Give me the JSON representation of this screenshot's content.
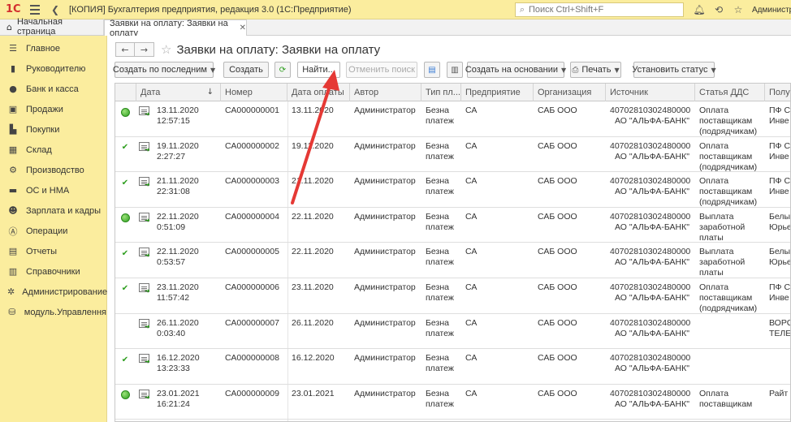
{
  "titlebar": {
    "logo": "1С",
    "app_title": "[КОПИЯ] Бухгалтерия предприятия, редакция 3.0  (1С:Предприятие)",
    "search_placeholder": "Поиск Ctrl+Shift+F",
    "user": "Администра",
    "colors": {
      "background": "#fbed9e"
    }
  },
  "tabs": {
    "home": "Начальная страница",
    "active": "Заявки на оплату: Заявки на оплату"
  },
  "sidebar": {
    "items": [
      {
        "label": "Главное",
        "icon": "menu-icon"
      },
      {
        "label": "Руководителю",
        "icon": "chart-icon"
      },
      {
        "label": "Банк и касса",
        "icon": "coin-icon"
      },
      {
        "label": "Продажи",
        "icon": "cart-icon"
      },
      {
        "label": "Покупки",
        "icon": "basket-icon"
      },
      {
        "label": "Склад",
        "icon": "warehouse-icon"
      },
      {
        "label": "Производство",
        "icon": "factory-icon"
      },
      {
        "label": "ОС и НМА",
        "icon": "truck-icon"
      },
      {
        "label": "Зарплата и кадры",
        "icon": "people-icon"
      },
      {
        "label": "Операции",
        "icon": "operations-icon"
      },
      {
        "label": "Отчеты",
        "icon": "report-icon"
      },
      {
        "label": "Справочники",
        "icon": "books-icon"
      },
      {
        "label": "Администрирование",
        "icon": "gear-icon"
      },
      {
        "label": "модуль.Управлення",
        "icon": "module-icon"
      }
    ]
  },
  "page": {
    "title": "Заявки на оплату: Заявки на оплату"
  },
  "toolbar": {
    "create_by_last": "Создать по последним",
    "create": "Создать",
    "find": "Найти...",
    "cancel_search": "Отменить поиск",
    "create_based_on": "Создать на основании",
    "print": "Печать",
    "set_status": "Установить статус"
  },
  "table": {
    "columns": [
      "Дата",
      "Номер",
      "Дата оплаты",
      "Автор",
      "Тип пл...",
      "Предприятие",
      "Организация",
      "Источник",
      "Статья ДДС",
      "Получ"
    ],
    "rows": [
      {
        "status": "green-dot",
        "date": "13.11.2020",
        "time": "12:57:15",
        "number": "СА000000001",
        "pay_date": "13.11.2020",
        "author": "Администратор",
        "type1": "Безна",
        "type2": "платеж",
        "enterprise": "СА",
        "org": "САБ ООО",
        "src1": "40702810302480000",
        "src2": "АО \"АЛЬФА-БАНК\"",
        "dds": "Оплата поставщикам (подрядчикам)",
        "recv1": "ПФ С",
        "recv2": "Инве"
      },
      {
        "status": "check",
        "date": "19.11.2020",
        "time": "2:27:27",
        "number": "СА000000002",
        "pay_date": "19.11.2020",
        "author": "Администратор",
        "type1": "Безна",
        "type2": "платеж",
        "enterprise": "СА",
        "org": "САБ ООО",
        "src1": "40702810302480000",
        "src2": "АО \"АЛЬФА-БАНК\"",
        "dds": "Оплата поставщикам (подрядчикам)",
        "recv1": "ПФ С",
        "recv2": "Инве"
      },
      {
        "status": "check",
        "date": "21.11.2020",
        "time": "22:31:08",
        "number": "СА000000003",
        "pay_date": "21.11.2020",
        "author": "Администратор",
        "type1": "Безна",
        "type2": "платеж",
        "enterprise": "СА",
        "org": "САБ ООО",
        "src1": "40702810302480000",
        "src2": "АО \"АЛЬФА-БАНК\"",
        "dds": "Оплата поставщикам (подрядчикам)",
        "recv1": "ПФ С",
        "recv2": "Инве"
      },
      {
        "status": "green-dot",
        "date": "22.11.2020",
        "time": "0:51:09",
        "number": "СА000000004",
        "pay_date": "22.11.2020",
        "author": "Администратор",
        "type1": "Безна",
        "type2": "платеж",
        "enterprise": "СА",
        "org": "САБ ООО",
        "src1": "40702810302480000",
        "src2": "АО \"АЛЬФА-БАНК\"",
        "dds": "Выплата заработной платы",
        "recv1": "Белы",
        "recv2": "Юрье"
      },
      {
        "status": "check",
        "date": "22.11.2020",
        "time": "0:53:57",
        "number": "СА000000005",
        "pay_date": "22.11.2020",
        "author": "Администратор",
        "type1": "Безна",
        "type2": "платеж",
        "enterprise": "СА",
        "org": "САБ ООО",
        "src1": "40702810302480000",
        "src2": "АО \"АЛЬФА-БАНК\"",
        "dds": "Выплата заработной платы",
        "recv1": "Белы",
        "recv2": "Юрье"
      },
      {
        "status": "check",
        "date": "23.11.2020",
        "time": "11:57:42",
        "number": "СА000000006",
        "pay_date": "23.11.2020",
        "author": "Администратор",
        "type1": "Безна",
        "type2": "платеж",
        "enterprise": "СА",
        "org": "САБ ООО",
        "src1": "40702810302480000",
        "src2": "АО \"АЛЬФА-БАНК\"",
        "dds": "Оплата поставщикам (подрядчикам)",
        "recv1": "ПФ С",
        "recv2": "Инве"
      },
      {
        "status": "none",
        "date": "26.11.2020",
        "time": "0:03:40",
        "number": "СА000000007",
        "pay_date": "26.11.2020",
        "author": "Администратор",
        "type1": "Безна",
        "type2": "платеж",
        "enterprise": "СА",
        "org": "САБ ООО",
        "src1": "40702810302480000",
        "src2": "АО \"АЛЬФА-БАНК\"",
        "dds": "",
        "recv1": "ВОРС",
        "recv2": "ТЕЛЕ"
      },
      {
        "status": "check",
        "date": "16.12.2020",
        "time": "13:23:33",
        "number": "СА000000008",
        "pay_date": "16.12.2020",
        "author": "Администратор",
        "type1": "Безна",
        "type2": "платеж",
        "enterprise": "СА",
        "org": "САБ ООО",
        "src1": "40702810302480000",
        "src2": "АО \"АЛЬФА-БАНК\"",
        "dds": "",
        "recv1": "",
        "recv2": ""
      },
      {
        "status": "green-dot",
        "date": "23.01.2021",
        "time": "16:21:24",
        "number": "СА000000009",
        "pay_date": "23.01.2021",
        "author": "Администратор",
        "type1": "Безна",
        "type2": "платеж",
        "enterprise": "СА",
        "org": "САБ ООО",
        "src1": "40702810302480000",
        "src2": "АО \"АЛЬФА-БАНК\"",
        "dds": "Оплата поставщикам",
        "recv1": "Райт",
        "recv2": ""
      }
    ]
  },
  "annotation": {
    "color": "#e53935"
  }
}
